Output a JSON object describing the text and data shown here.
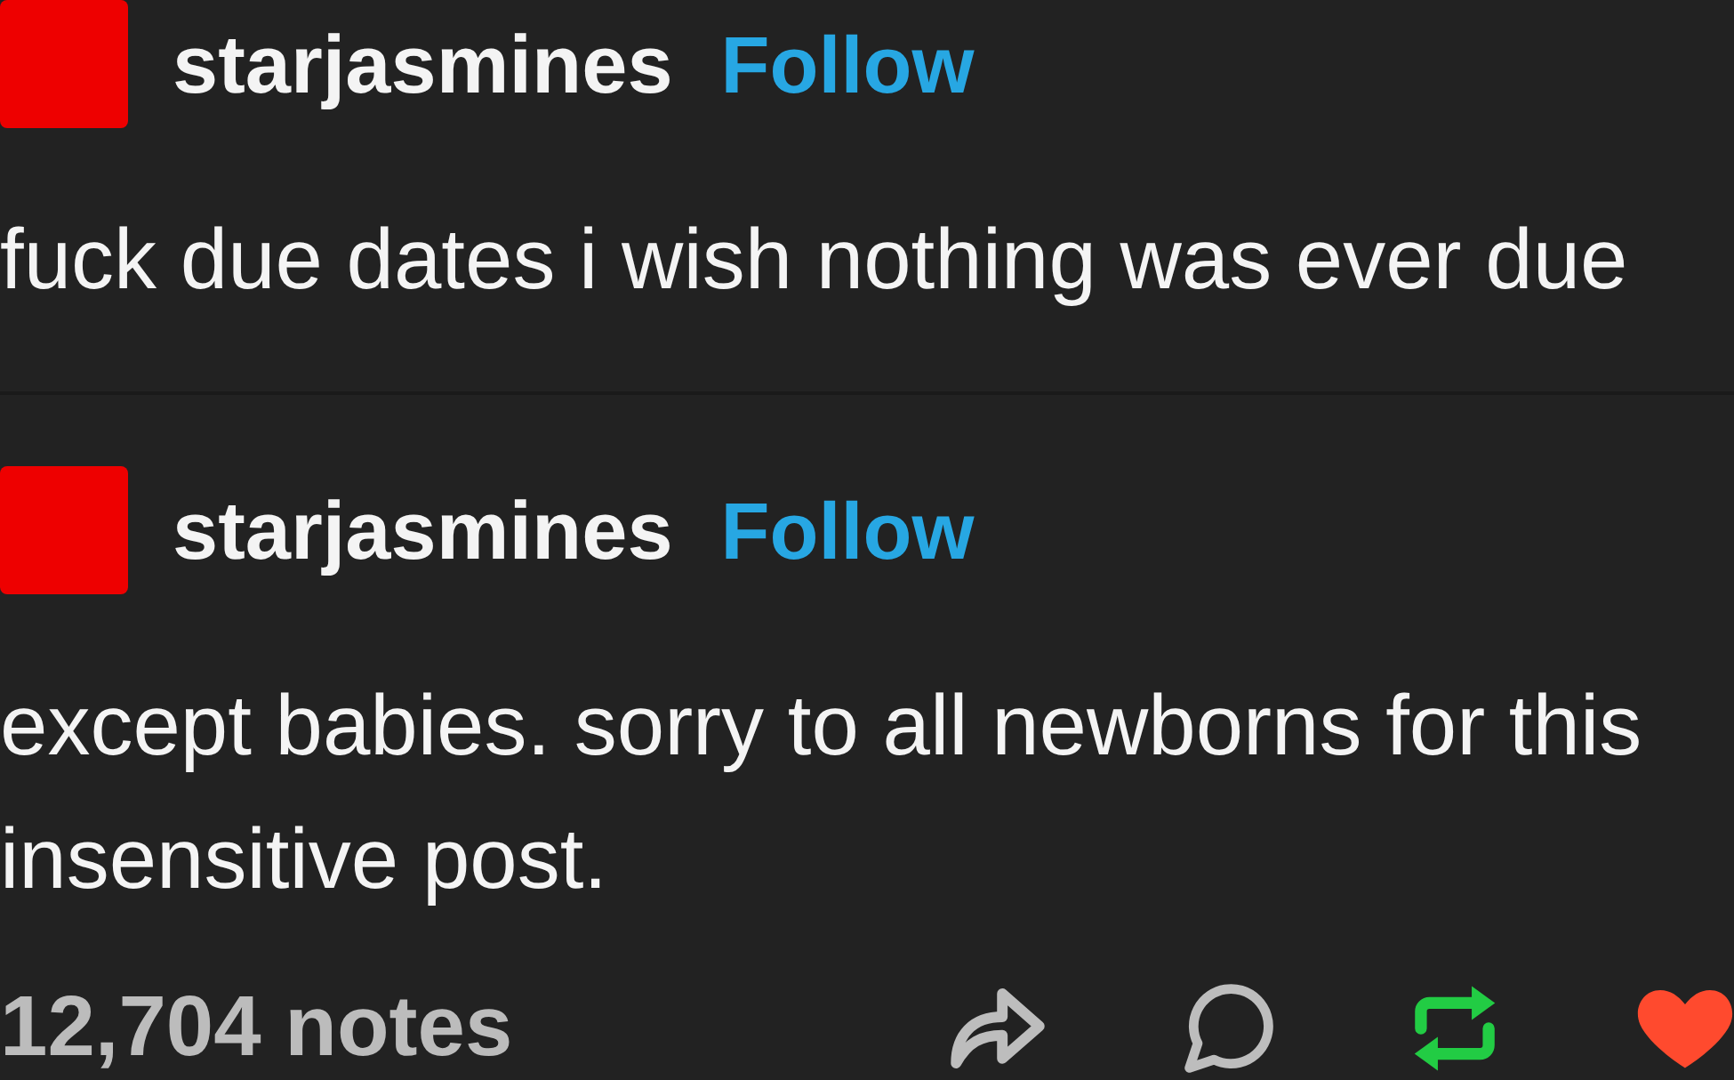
{
  "posts": [
    {
      "author": {
        "name": "starjasmines",
        "follow": "Follow"
      },
      "text": "fuck due dates i wish nothing was ever due"
    },
    {
      "author": {
        "name": "starjasmines",
        "follow": "Follow"
      },
      "text": "except babies. sorry to all newborns for this insensitive post."
    }
  ],
  "footer": {
    "notes": "12,704 notes",
    "actions": [
      {
        "kind": "share",
        "on": false
      },
      {
        "kind": "reply",
        "on": false
      },
      {
        "kind": "reblog",
        "on": true
      },
      {
        "kind": "like",
        "on": true
      }
    ]
  }
}
